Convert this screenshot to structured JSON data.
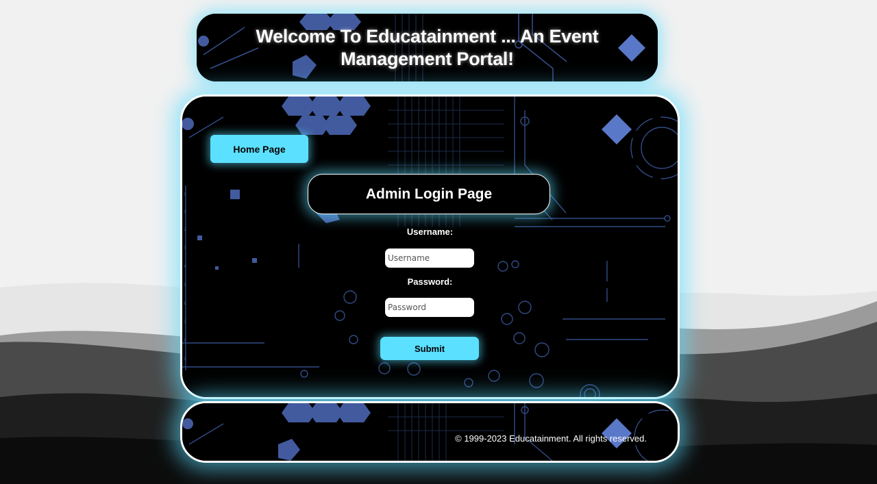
{
  "header": {
    "title": "Welcome To Educatainment ... An Event Management Portal!"
  },
  "nav": {
    "home_label": "Home Page"
  },
  "login": {
    "title": "Admin Login Page",
    "username_label": "Username:",
    "username_placeholder": "Username",
    "password_label": "Password:",
    "password_placeholder": "Password",
    "submit_label": "Submit"
  },
  "footer": {
    "copyright": "© 1999-2023 Educatainment. All rights reserved."
  },
  "colors": {
    "accent": "#5be0ff",
    "panel_bg": "#000000",
    "circuit_blue": "#5a78c8",
    "page_bg": "#f1f1f1"
  }
}
